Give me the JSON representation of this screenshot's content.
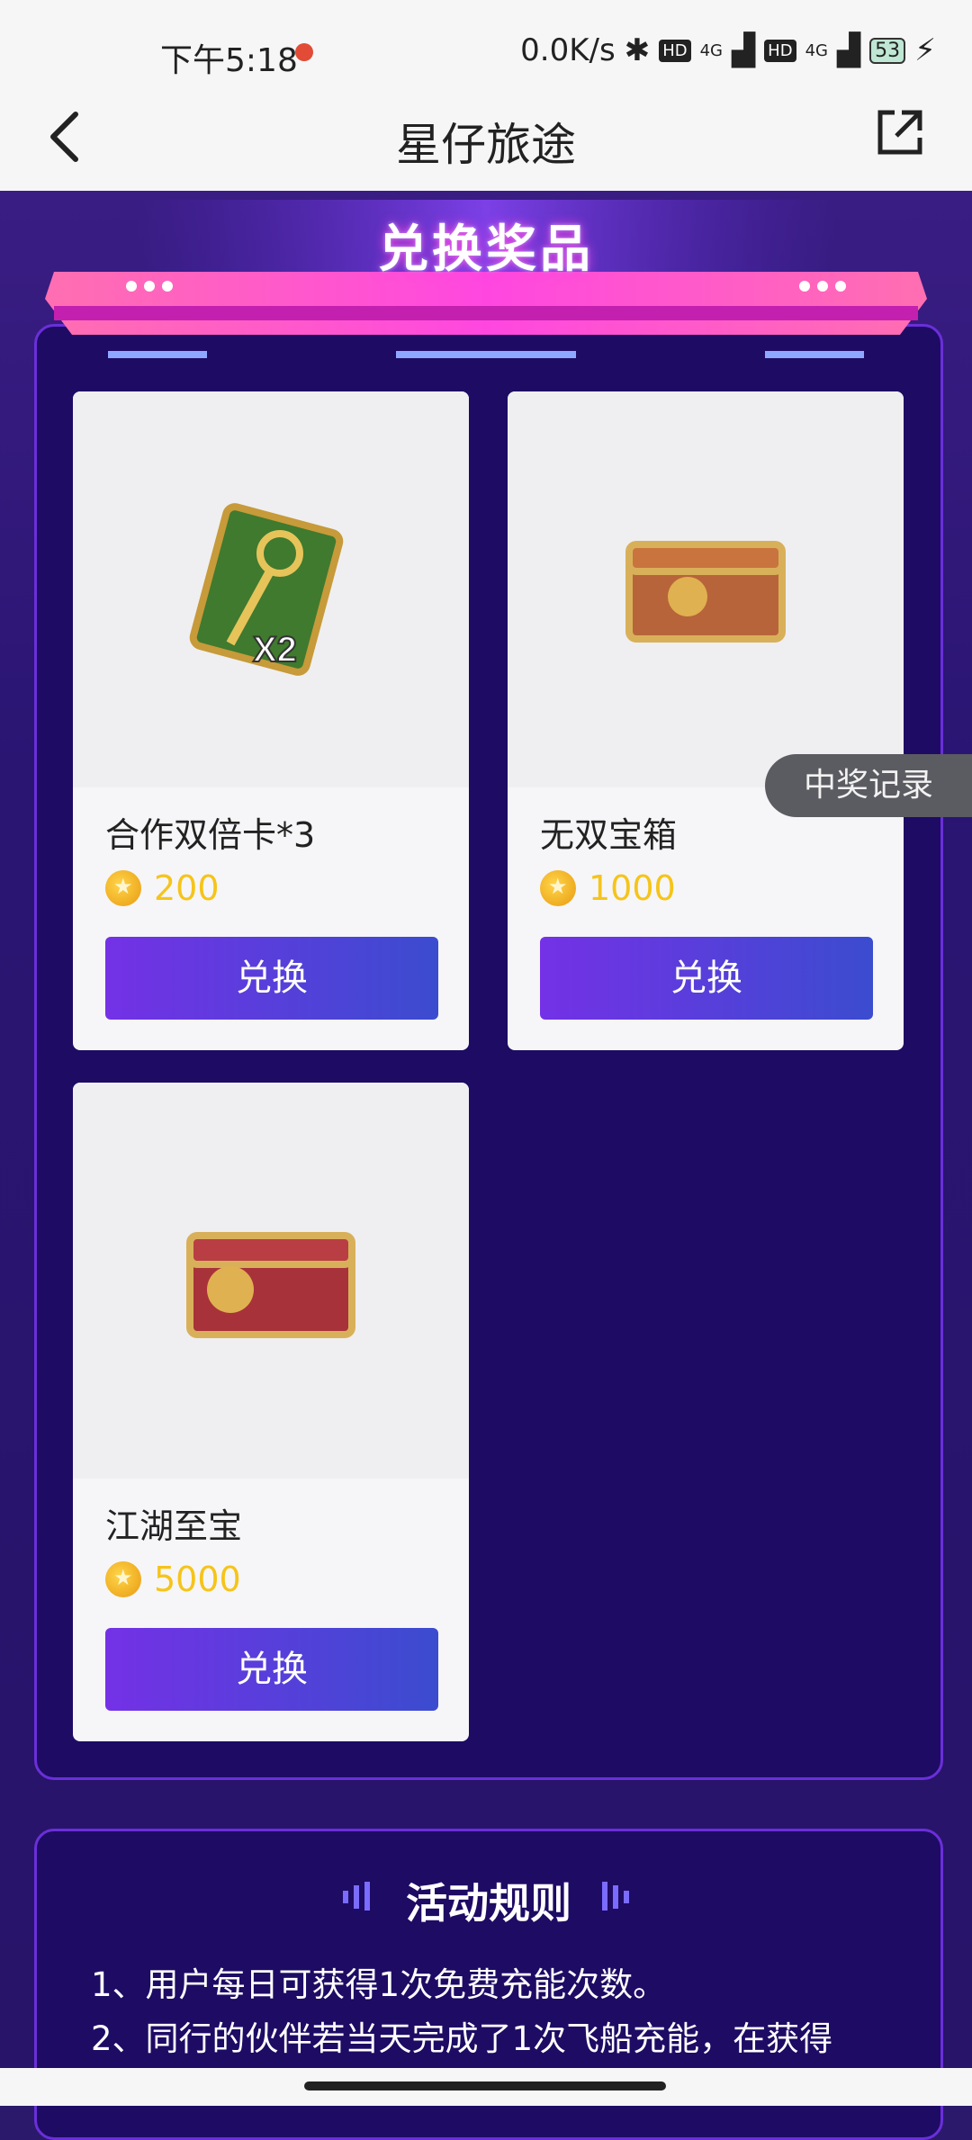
{
  "status": {
    "time": "下午5:18",
    "net_speed": "0.0K/s",
    "badge1": "HD",
    "signal1": "4G",
    "badge2": "HD",
    "signal2": "4G",
    "battery": "53"
  },
  "nav": {
    "back_icon": "chevron-left-icon",
    "title": "星仔旅途",
    "share_icon": "external-link-icon"
  },
  "banner": {
    "title": "兑换奖品"
  },
  "records_label": "中奖记录",
  "prizes": [
    {
      "name": "合作双倍卡*3",
      "price": "200",
      "button": "兑换",
      "icon": "key-card-icon"
    },
    {
      "name": "无双宝箱",
      "price": "1000",
      "button": "兑换",
      "icon": "bronze-chest-icon"
    },
    {
      "name": "江湖至宝",
      "price": "5000",
      "button": "兑换",
      "icon": "dragon-chest-icon"
    }
  ],
  "rules": {
    "title": "活动规则",
    "lines": [
      "1、用户每日可获得1次免费充能次数。",
      "2、同行的伙伴若当天完成了1次飞船充能，在获得"
    ]
  },
  "colors": {
    "accent": "#7431e6",
    "panel": "#1e0b64",
    "price": "#f6c41a"
  }
}
